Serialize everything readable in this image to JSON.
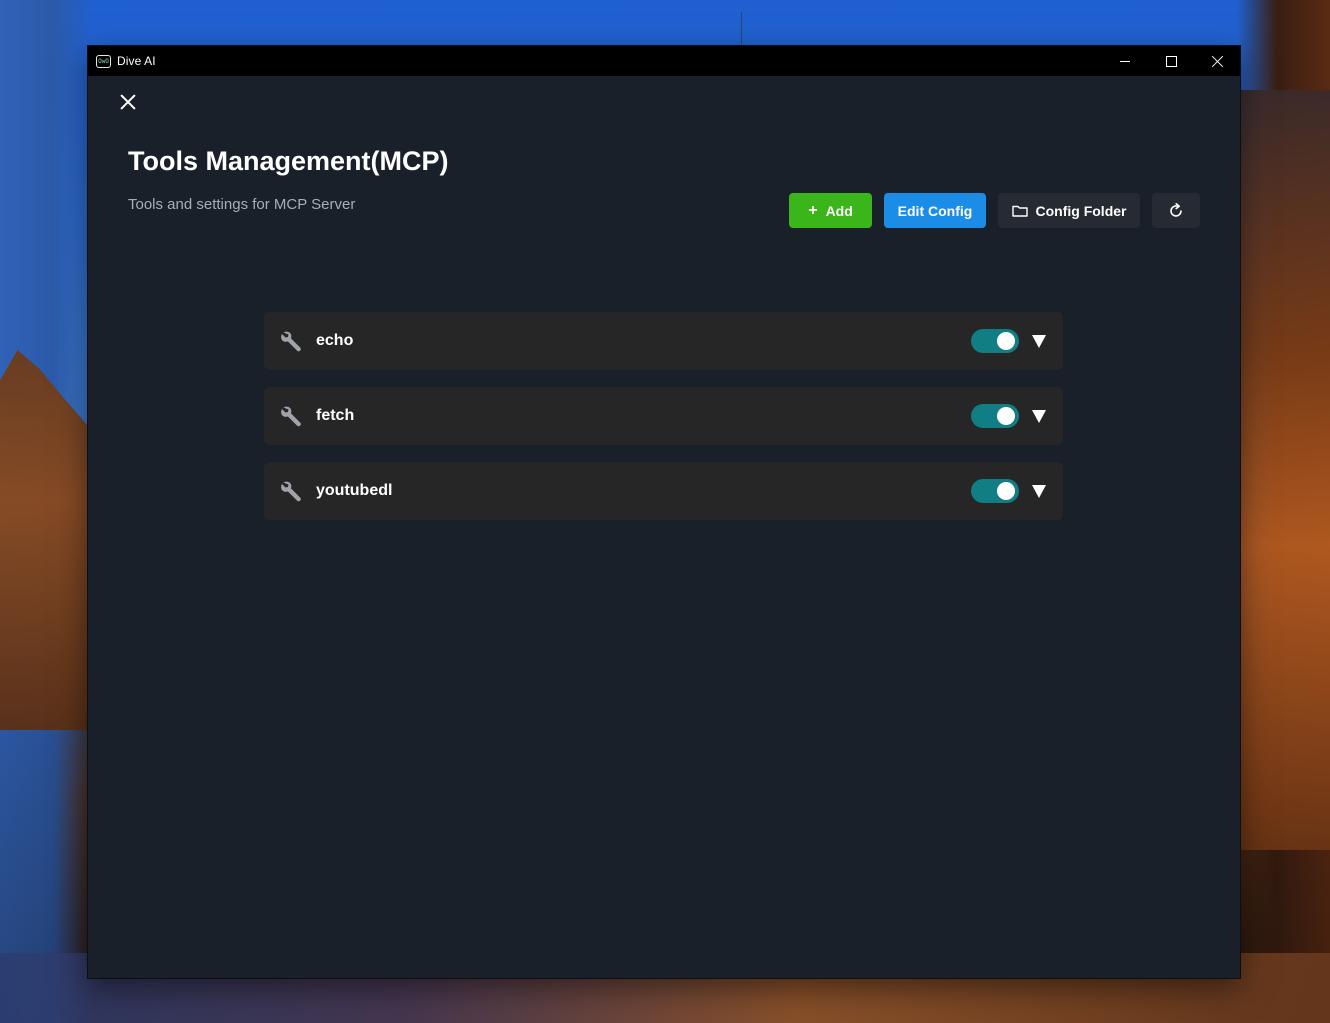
{
  "window": {
    "title": "Dive AI",
    "app_icon_text": "OwO"
  },
  "page": {
    "title": "Tools Management(MCP)",
    "subtitle": "Tools and settings for MCP Server"
  },
  "toolbar": {
    "add_label": "Add",
    "edit_config_label": "Edit Config",
    "config_folder_label": "Config Folder"
  },
  "tools": [
    {
      "name": "echo",
      "enabled": true
    },
    {
      "name": "fetch",
      "enabled": true
    },
    {
      "name": "youtubedl",
      "enabled": true
    }
  ],
  "colors": {
    "add_button": "#3ab51a",
    "edit_config_button": "#1b8de6",
    "toggle_on": "#117e86",
    "panel_background": "#19202a",
    "row_background": "#262626"
  },
  "icons": {
    "close": "close-icon",
    "plus": "plus-icon",
    "folder": "folder-icon",
    "refresh": "refresh-icon",
    "tool": "wrench-icon",
    "expand": "chevron-down-icon"
  }
}
